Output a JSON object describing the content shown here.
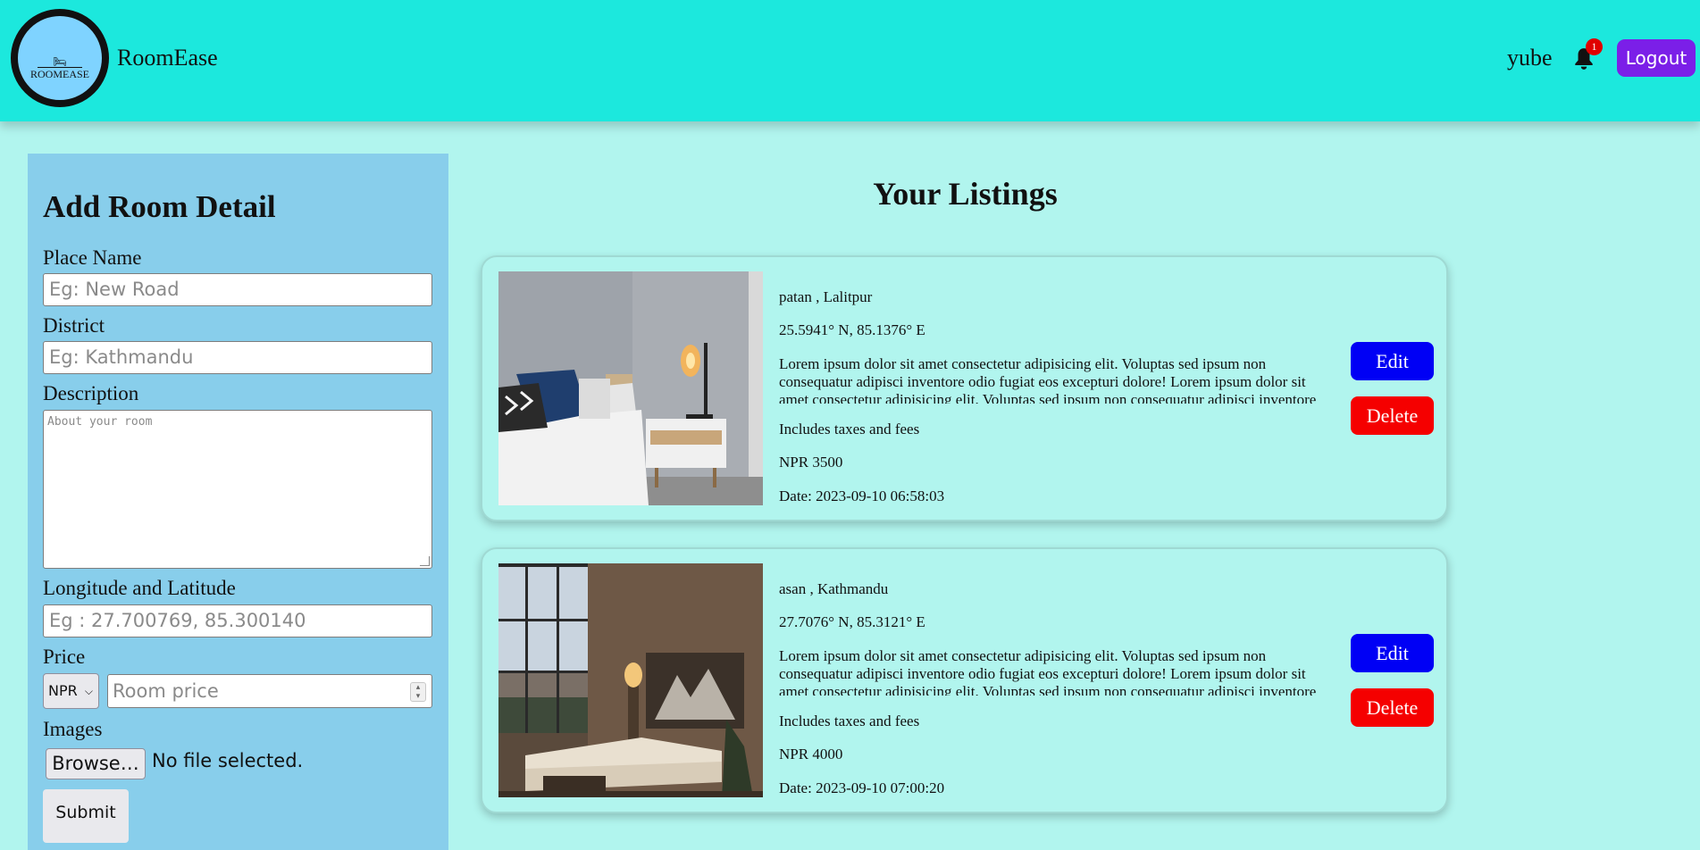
{
  "header": {
    "logo_text": "ROOMEASE",
    "brand": "RoomEase",
    "username": "yube",
    "notification_count": "1",
    "logout_label": "Logout"
  },
  "form": {
    "title": "Add Room Detail",
    "place_label": "Place Name",
    "place_placeholder": "Eg: New Road",
    "district_label": "District",
    "district_placeholder": "Eg: Kathmandu",
    "description_label": "Description",
    "description_placeholder": "About your room",
    "coords_label": "Longitude and Latitude",
    "coords_placeholder": "Eg : 27.700769, 85.300140",
    "price_label": "Price",
    "currency_selected": "NPR",
    "price_placeholder": "Room price",
    "images_label": "Images",
    "browse_label": "Browse…",
    "file_status": "No file selected.",
    "submit_label": "Submit"
  },
  "listings": {
    "title": "Your Listings",
    "items": [
      {
        "location": "patan , Lalitpur",
        "coords": "25.5941° N, 85.1376° E",
        "description": "Lorem ipsum dolor sit amet consectetur adipisicing elit. Voluptas sed ipsum non consequatur adipisci inventore odio fugiat eos excepturi dolore! Lorem ipsum dolor sit amet consectetur adipisicing elit. Voluptas sed ipsum non consequatur adipisci inventore",
        "tax_note": "Includes taxes and fees",
        "price": "NPR 3500",
        "date": "Date: 2023-09-10 06:58:03",
        "edit_label": "Edit",
        "delete_label": "Delete"
      },
      {
        "location": "asan , Kathmandu",
        "coords": "27.7076° N, 85.3121° E",
        "description": "Lorem ipsum dolor sit amet consectetur adipisicing elit. Voluptas sed ipsum non consequatur adipisci inventore odio fugiat eos excepturi dolore! Lorem ipsum dolor sit amet consectetur adipisicing elit. Voluptas sed ipsum non consequatur adipisci inventore",
        "tax_note": "Includes taxes and fees",
        "price": "NPR 4000",
        "date": "Date: 2023-09-10 07:00:20",
        "edit_label": "Edit",
        "delete_label": "Delete"
      }
    ]
  },
  "colors": {
    "header_bg": "#1ce8dd",
    "page_bg": "#b1f5ee",
    "form_bg": "#88ceeb",
    "logout_bg": "#7b1fe8",
    "edit_bg": "#0000f5",
    "delete_bg": "#f50000"
  }
}
